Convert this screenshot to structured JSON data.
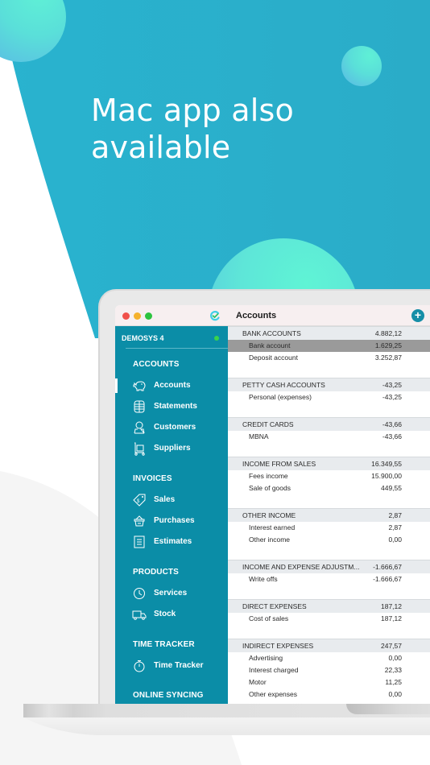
{
  "promo": {
    "headline_line1": "Mac app also",
    "headline_line2": "available"
  },
  "window": {
    "title": "Accounts",
    "add_button": "+",
    "icons": {
      "app_logo": "app-logo-icon",
      "add": "plus-circle-icon"
    }
  },
  "sidebar": {
    "company": "DEMOSYS 4",
    "sync_status": "online",
    "sections": [
      {
        "title": "ACCOUNTS",
        "items": [
          {
            "label": "Accounts",
            "icon": "piggy-bank-icon",
            "active": true
          },
          {
            "label": "Statements",
            "icon": "coins-stack-icon"
          },
          {
            "label": "Customers",
            "icon": "person-icon"
          },
          {
            "label": "Suppliers",
            "icon": "hand-truck-icon"
          }
        ]
      },
      {
        "title": "INVOICES",
        "items": [
          {
            "label": "Sales",
            "icon": "price-tag-icon"
          },
          {
            "label": "Purchases",
            "icon": "basket-icon"
          },
          {
            "label": "Estimates",
            "icon": "clipboard-list-icon"
          }
        ]
      },
      {
        "title": "PRODUCTS",
        "items": [
          {
            "label": "Services",
            "icon": "clock-icon"
          },
          {
            "label": "Stock",
            "icon": "truck-icon"
          }
        ]
      },
      {
        "title": "TIME TRACKER",
        "items": [
          {
            "label": "Time Tracker",
            "icon": "stopwatch-icon"
          }
        ]
      },
      {
        "title": "ONLINE SYNCING",
        "items": []
      }
    ]
  },
  "accounts": {
    "groups": [
      {
        "name": "BANK ACCOUNTS",
        "total": "4.882,12",
        "rows": [
          {
            "name": "Bank account",
            "value": "1.629,25",
            "selected": true
          },
          {
            "name": "Deposit account",
            "value": "3.252,87"
          }
        ]
      },
      {
        "name": "PETTY CASH ACCOUNTS",
        "total": "-43,25",
        "rows": [
          {
            "name": "Personal (expenses)",
            "value": "-43,25"
          }
        ]
      },
      {
        "name": "CREDIT CARDS",
        "total": "-43,66",
        "rows": [
          {
            "name": "MBNA",
            "value": "-43,66"
          }
        ]
      },
      {
        "name": "INCOME FROM SALES",
        "total": "16.349,55",
        "rows": [
          {
            "name": "Fees income",
            "value": "15.900,00"
          },
          {
            "name": "Sale of goods",
            "value": "449,55"
          }
        ]
      },
      {
        "name": "OTHER INCOME",
        "total": "2,87",
        "rows": [
          {
            "name": "Interest earned",
            "value": "2,87"
          },
          {
            "name": "Other income",
            "value": "0,00"
          }
        ]
      },
      {
        "name": "INCOME AND EXPENSE ADJUSTM...",
        "total": "-1.666,67",
        "rows": [
          {
            "name": "Write offs",
            "value": "-1.666,67"
          }
        ]
      },
      {
        "name": "DIRECT EXPENSES",
        "total": "187,12",
        "rows": [
          {
            "name": "Cost of sales",
            "value": "187,12"
          }
        ]
      },
      {
        "name": "INDIRECT EXPENSES",
        "total": "247,57",
        "rows": [
          {
            "name": "Advertising",
            "value": "0,00"
          },
          {
            "name": "Interest charged",
            "value": "22,33"
          },
          {
            "name": "Motor",
            "value": "11,25"
          },
          {
            "name": "Other expenses",
            "value": "0,00"
          }
        ]
      }
    ]
  },
  "colors": {
    "background_teal": "#2bb0cc",
    "sidebar": "#0b8da7",
    "accent_ball": "#5ff0d6",
    "selected_row": "#9a9a9a",
    "group_header": "#e8ebee"
  }
}
